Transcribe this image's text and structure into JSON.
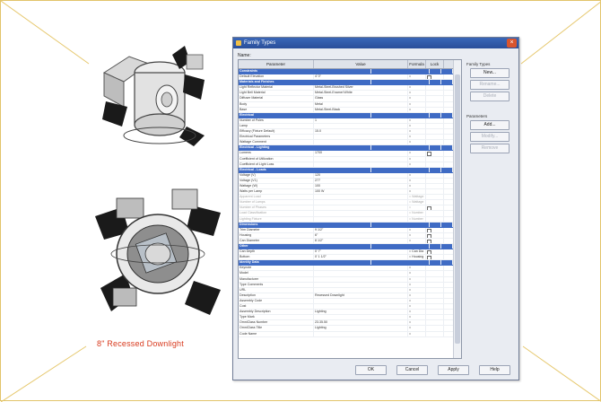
{
  "caption": "8\" Recessed Downlight",
  "dialog": {
    "title": "Family Types",
    "type_label": "Name:",
    "columns": [
      "Parameter",
      "Value",
      "Formula",
      "Lock"
    ],
    "rows": [
      {
        "g": true,
        "p": "Constraints"
      },
      {
        "p": "Default Elevation",
        "v": "4' 0\"",
        "f": "=",
        "l": "x"
      },
      {
        "g": true,
        "p": "Materials and Finishes"
      },
      {
        "p": "Light Reflector Material",
        "v": "Metal-Steel-Brushed Silver",
        "f": "="
      },
      {
        "p": "Light Bell Material",
        "v": "Metal-Steel-Enamel White",
        "f": "="
      },
      {
        "p": "Diffuser Material",
        "v": "Glass",
        "f": "="
      },
      {
        "p": "Body",
        "v": "Metal",
        "f": "="
      },
      {
        "p": "Base",
        "v": "Metal-Steel-Black",
        "f": "="
      },
      {
        "g": true,
        "p": "Electrical"
      },
      {
        "p": "Number of Poles",
        "v": "1",
        "f": "="
      },
      {
        "p": "Lamp",
        "v": "",
        "f": "="
      },
      {
        "p": "Efficacy (Fixture Default)",
        "v": "15.0",
        "f": "="
      },
      {
        "p": "Electrical Parameters",
        "v": "",
        "f": "="
      },
      {
        "p": "Wattage Comment",
        "v": "",
        "f": "="
      },
      {
        "g": true,
        "p": "Electrical - Lighting"
      },
      {
        "p": "Lumens",
        "v": "1700",
        "f": "=",
        "l": "x"
      },
      {
        "p": "Coefficient of Utilization",
        "v": "",
        "f": "="
      },
      {
        "p": "Coefficient of Light Loss",
        "v": "",
        "f": "="
      },
      {
        "g": true,
        "p": "Electrical - Loads"
      },
      {
        "p": "Voltage (V)",
        "v": "120",
        "f": "="
      },
      {
        "p": "Voltage (V1)",
        "v": "277",
        "f": "="
      },
      {
        "p": "Wattage (W)",
        "v": "100",
        "f": "="
      },
      {
        "p": "Watts per Lamp",
        "v": "100 W",
        "f": "="
      },
      {
        "p": "Apparent Load",
        "v": "",
        "f": "= Wattage",
        "d": true
      },
      {
        "p": "Number of Lamps",
        "v": "",
        "f": "= Wattage",
        "d": true
      },
      {
        "p": "Number of Phases",
        "v": "",
        "f": "=",
        "l": "x",
        "d": true
      },
      {
        "p": "Load Classification",
        "v": "",
        "f": "= Number",
        "d": true
      },
      {
        "p": "Lighting Fixture",
        "v": "",
        "f": "= Number",
        "d": true
      },
      {
        "g": true,
        "p": "Dimensions"
      },
      {
        "p": "Trim Diameter",
        "v": "9 1/2\"",
        "f": "=",
        "l": "x"
      },
      {
        "p": "Housing",
        "v": "6\"",
        "f": "=",
        "l": "x"
      },
      {
        "p": "Can Diameter",
        "v": "8 1/2\"",
        "f": "=",
        "l": "x"
      },
      {
        "g": true,
        "p": "Other"
      },
      {
        "p": "Can Depth",
        "v": "0' 7\"",
        "f": "= Can Dia",
        "l": "x"
      },
      {
        "p": "Bottom",
        "v": "0' 1 1/2\"",
        "f": "= Housing",
        "l": "x"
      },
      {
        "g": true,
        "p": "Identity Data"
      },
      {
        "p": "Keynote",
        "v": "",
        "f": "="
      },
      {
        "p": "Model",
        "v": "",
        "f": "="
      },
      {
        "p": "Manufacturer",
        "v": "",
        "f": "="
      },
      {
        "p": "Type Comments",
        "v": "",
        "f": "="
      },
      {
        "p": "URL",
        "v": "",
        "f": "="
      },
      {
        "p": "Description",
        "v": "Recessed Downlight",
        "f": "="
      },
      {
        "p": "Assembly Code",
        "v": "",
        "f": "="
      },
      {
        "p": "Cost",
        "v": "",
        "f": "="
      },
      {
        "p": "Assembly Description",
        "v": "Lighting",
        "f": "="
      },
      {
        "p": "Type Mark",
        "v": "",
        "f": "="
      },
      {
        "p": "OmniClass Number",
        "v": "23.35.50",
        "f": "="
      },
      {
        "p": "OmniClass Title",
        "v": "Lighting",
        "f": "="
      },
      {
        "p": "Code Name",
        "v": "",
        "f": "="
      }
    ],
    "side": {
      "family_types_label": "Family Types",
      "new": "New...",
      "rename": "Rename...",
      "delete": "Delete",
      "parameters_label": "Parameters",
      "add": "Add...",
      "modify": "Modify...",
      "remove": "Remove"
    },
    "buttons": {
      "ok": "OK",
      "cancel": "Cancel",
      "apply": "Apply",
      "help": "Help"
    },
    "close_glyph": "×"
  }
}
